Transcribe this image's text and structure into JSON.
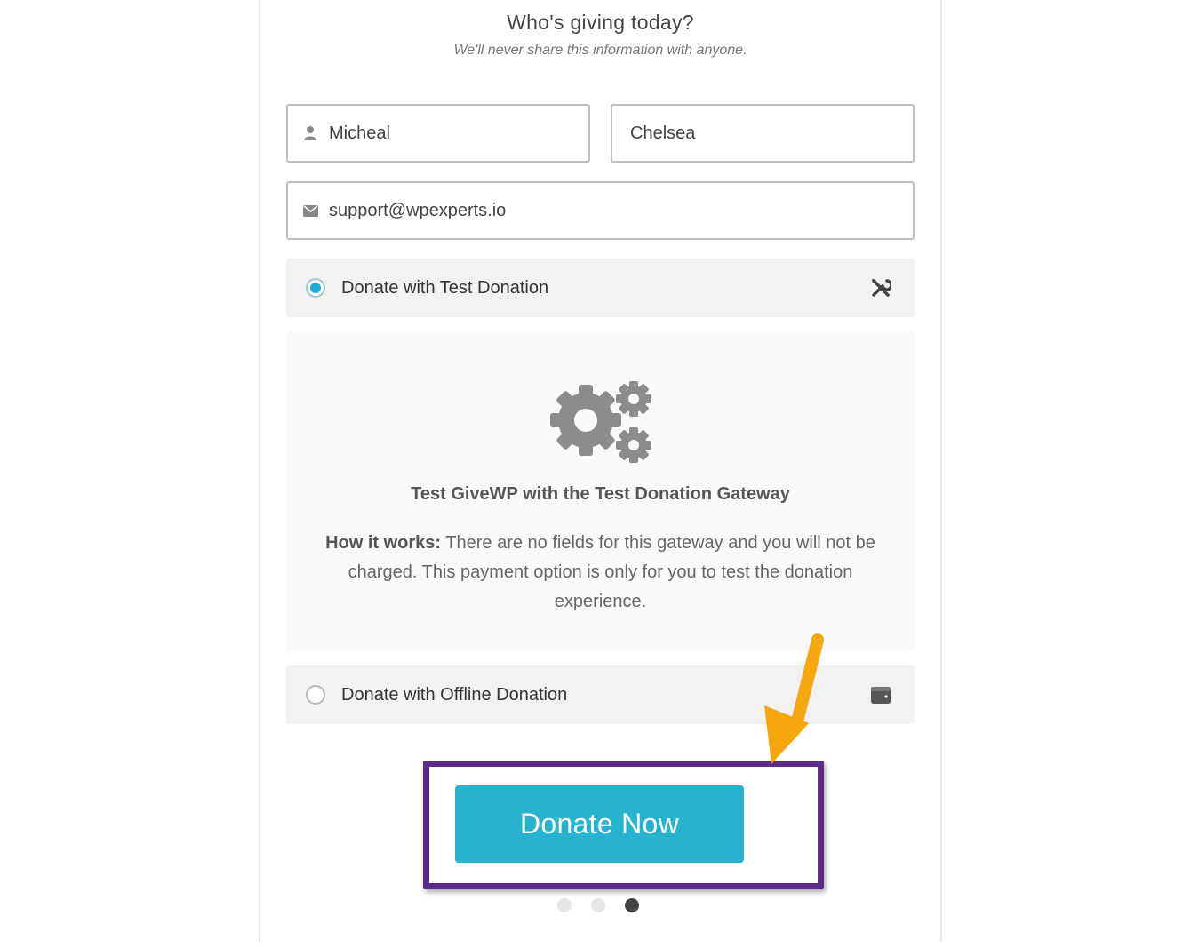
{
  "header": {
    "title": "Who's giving today?",
    "subtitle": "We'll never share this information with anyone."
  },
  "form": {
    "first_name": "Micheal",
    "last_name": "Chelsea",
    "email": "support@wpexperts.io"
  },
  "gateways": [
    {
      "label": "Donate with Test Donation",
      "selected": true,
      "icon": "tools-icon"
    },
    {
      "label": "Donate with Offline Donation",
      "selected": false,
      "icon": "wallet-icon"
    }
  ],
  "test_panel": {
    "title": "Test GiveWP with the Test Donation Gateway",
    "how_label": "How it works:",
    "how_text": " There are no fields for this gateway and you will not be charged. This payment option is only for you to test the donation experience."
  },
  "submit": {
    "label": "Donate Now"
  },
  "pager": {
    "total": 3,
    "current": 3
  },
  "colors": {
    "button": "#27b3cf",
    "radio_selected": "#27a8d6",
    "highlight_box": "#5d2a8c",
    "arrow": "#f5a70d"
  }
}
